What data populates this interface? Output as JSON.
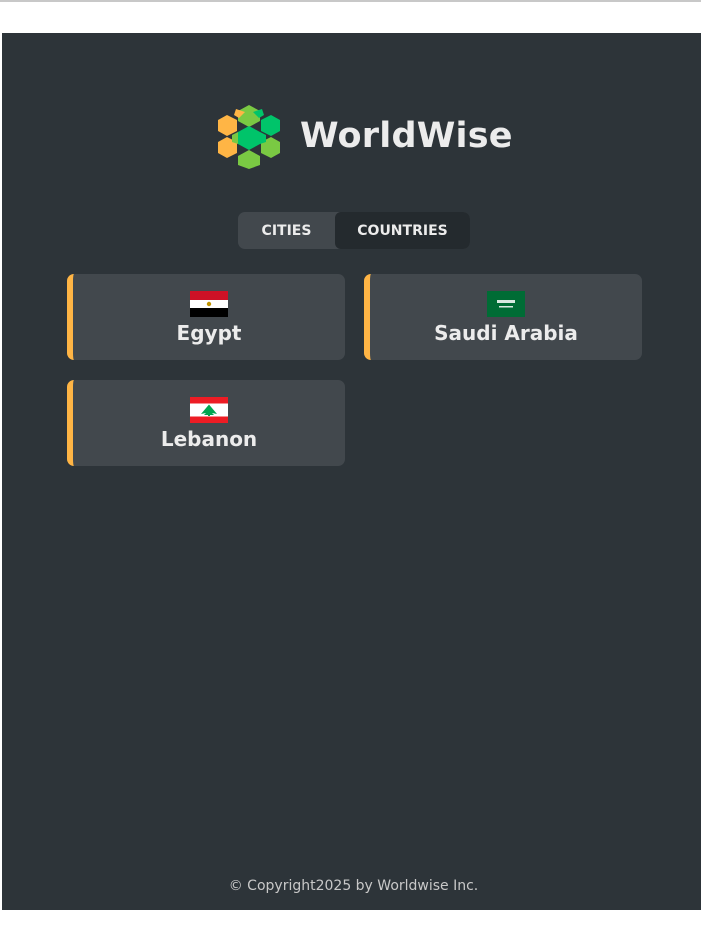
{
  "app": {
    "name": "WorldWise",
    "colors": {
      "panel": "#2d3439",
      "tab_bar": "#42484d",
      "active_tab": "#242a2e",
      "card": "#42484d",
      "accent": "#ffb545",
      "text": "#ececec",
      "muted_text": "#c8c8c8"
    }
  },
  "logo": {
    "icon": "globe-hex-icon",
    "text": "WorldWise"
  },
  "tabs": [
    {
      "label": "CITIES",
      "active": false
    },
    {
      "label": "COUNTRIES",
      "active": true
    }
  ],
  "countries": [
    {
      "name": "Egypt",
      "flag": "egypt-flag-icon"
    },
    {
      "name": "Saudi Arabia",
      "flag": "saudi-arabia-flag-icon"
    },
    {
      "name": "Lebanon",
      "flag": "lebanon-flag-icon"
    }
  ],
  "footer": {
    "copyright": "© Copyright2025 by Worldwise Inc."
  }
}
